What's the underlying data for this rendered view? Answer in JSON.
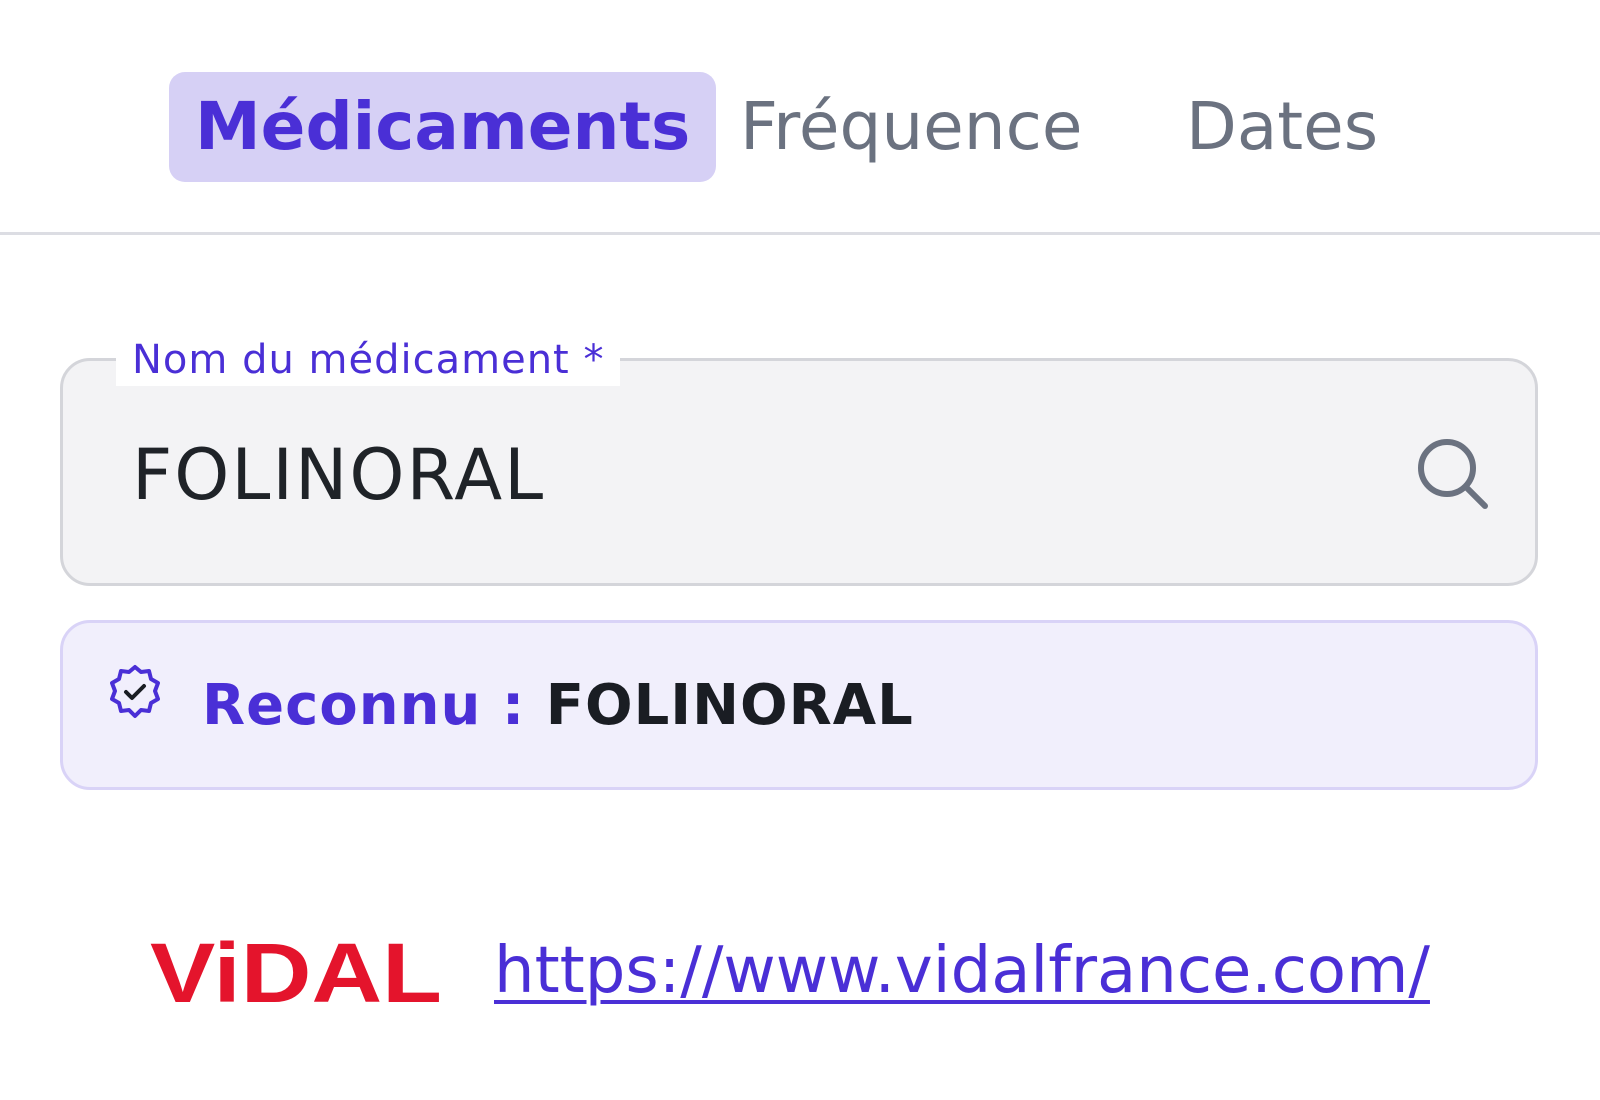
{
  "tabs": [
    {
      "label": "Médicaments",
      "active": true
    },
    {
      "label": "Fréquence",
      "active": false
    },
    {
      "label": "Dates",
      "active": false
    }
  ],
  "medication_field": {
    "label": "Nom du médicament *",
    "value": "FOLINORAL",
    "icon": "search-icon"
  },
  "recognition": {
    "icon": "verified-badge-icon",
    "prefix": "Reconnu : ",
    "name": "FOLINORAL"
  },
  "footer": {
    "logo_text": "ViDAL",
    "link": "https://www.vidalfrance.com/"
  },
  "colors": {
    "accent": "#4a2fd6",
    "active_tab_bg": "#d6d0f5",
    "inactive_tab": "#6b7280",
    "vidal_red": "#e4142c"
  }
}
